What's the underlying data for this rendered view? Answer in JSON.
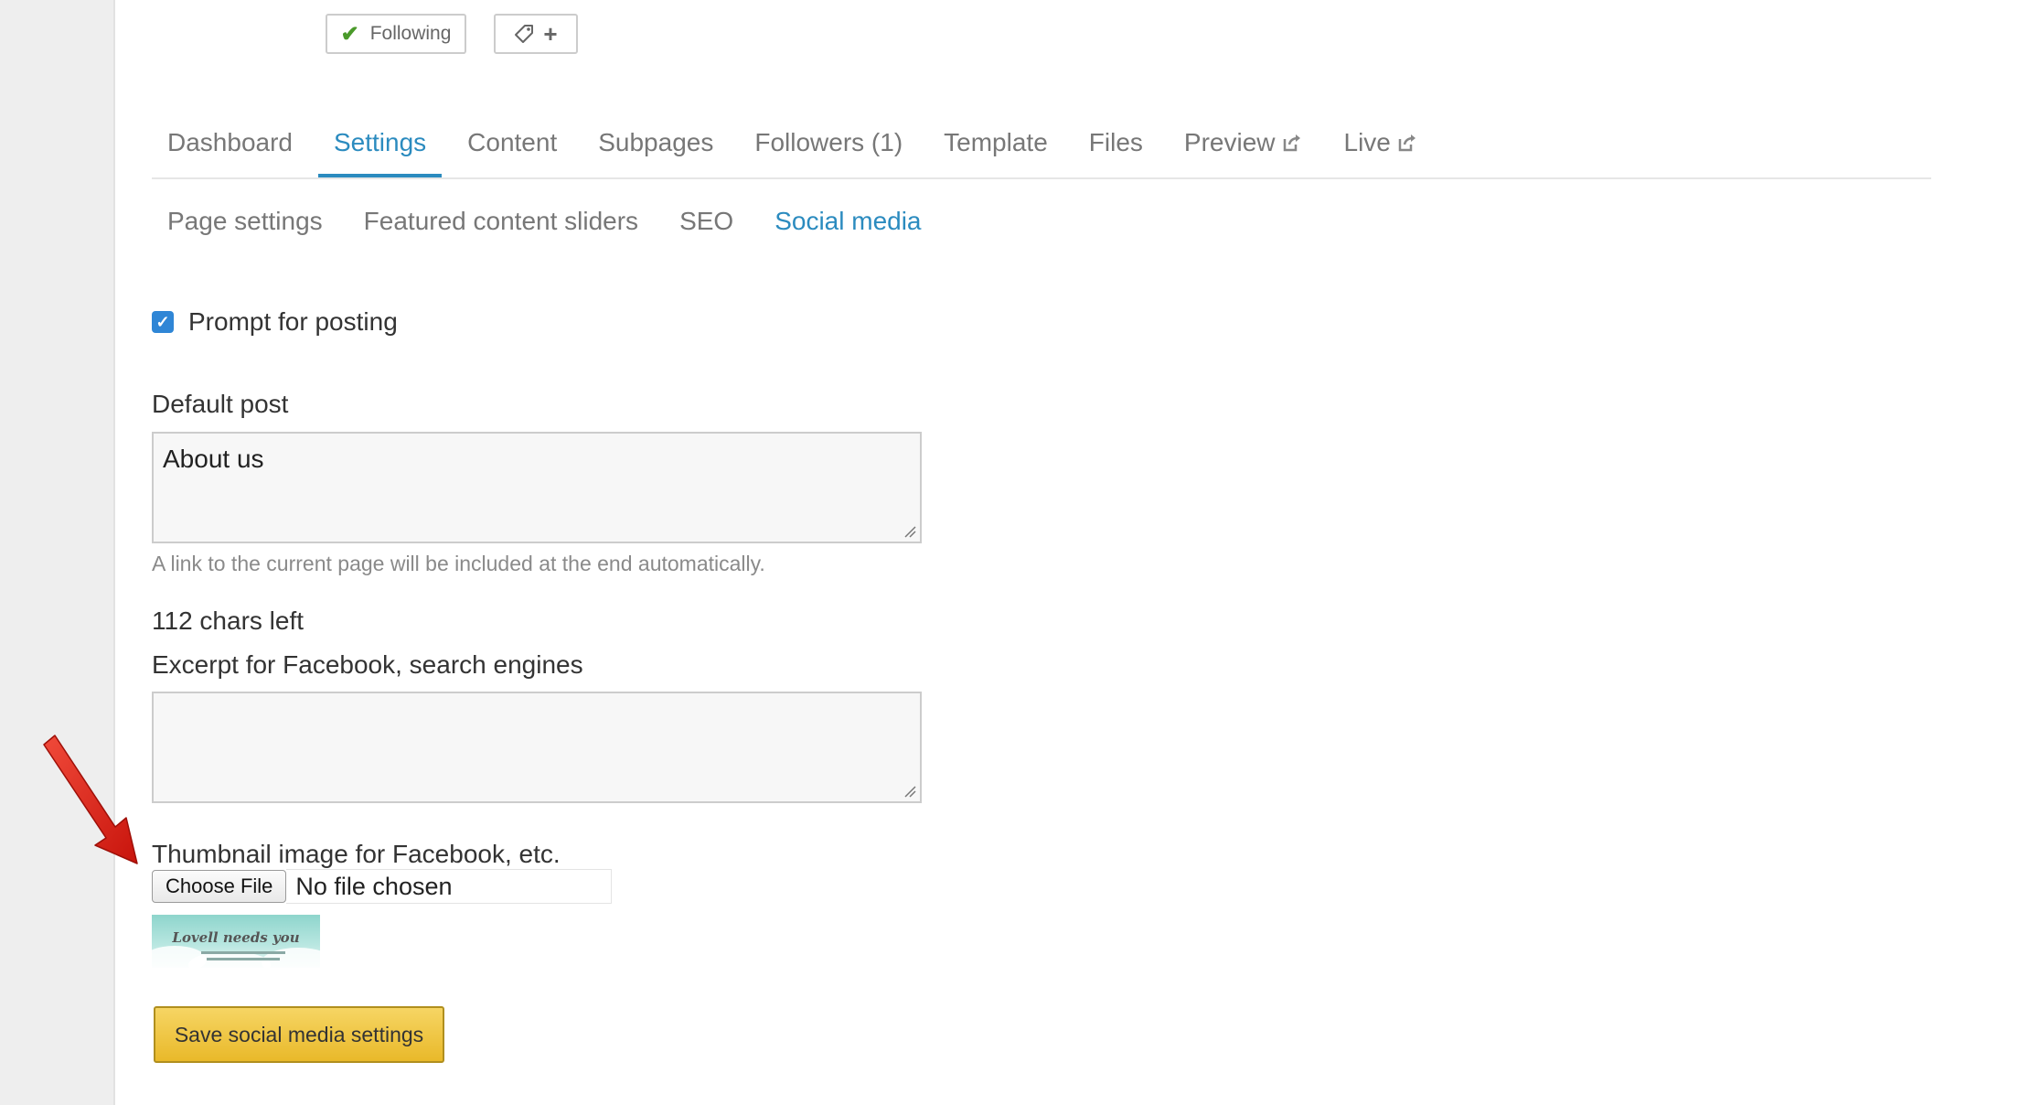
{
  "header": {
    "following_label": "Following"
  },
  "main_tabs": [
    {
      "label": "Dashboard",
      "active": false
    },
    {
      "label": "Settings",
      "active": true
    },
    {
      "label": "Content",
      "active": false
    },
    {
      "label": "Subpages",
      "active": false
    },
    {
      "label": "Followers (1)",
      "active": false
    },
    {
      "label": "Template",
      "active": false
    },
    {
      "label": "Files",
      "active": false
    },
    {
      "label": "Preview",
      "active": false,
      "external": true
    },
    {
      "label": "Live",
      "active": false,
      "external": true
    }
  ],
  "sub_tabs": [
    {
      "label": "Page settings",
      "active": false
    },
    {
      "label": "Featured content sliders",
      "active": false
    },
    {
      "label": "SEO",
      "active": false
    },
    {
      "label": "Social media",
      "active": true
    }
  ],
  "form": {
    "prompt_label": "Prompt for posting",
    "prompt_checked": true,
    "default_post_label": "Default post",
    "default_post_value": "About us",
    "default_post_help": "A link to the current page will be included at the end automatically.",
    "chars_left": "112 chars left",
    "excerpt_label": "Excerpt for Facebook, search engines",
    "excerpt_value": "",
    "thumbnail_label": "Thumbnail image for Facebook, etc.",
    "choose_file_label": "Choose File",
    "file_status": "No file chosen",
    "thumbnail_caption": "Lovell needs you",
    "save_label": "Save social media settings"
  },
  "colors": {
    "accent": "#2b8bbf",
    "save_button": "#f0c53a",
    "arrow": "#e0261c",
    "check": "#4a9a2a"
  },
  "icons": {
    "following": "check-icon",
    "tag": "tag-icon",
    "add": "plus-icon",
    "external": "external-link-icon"
  }
}
